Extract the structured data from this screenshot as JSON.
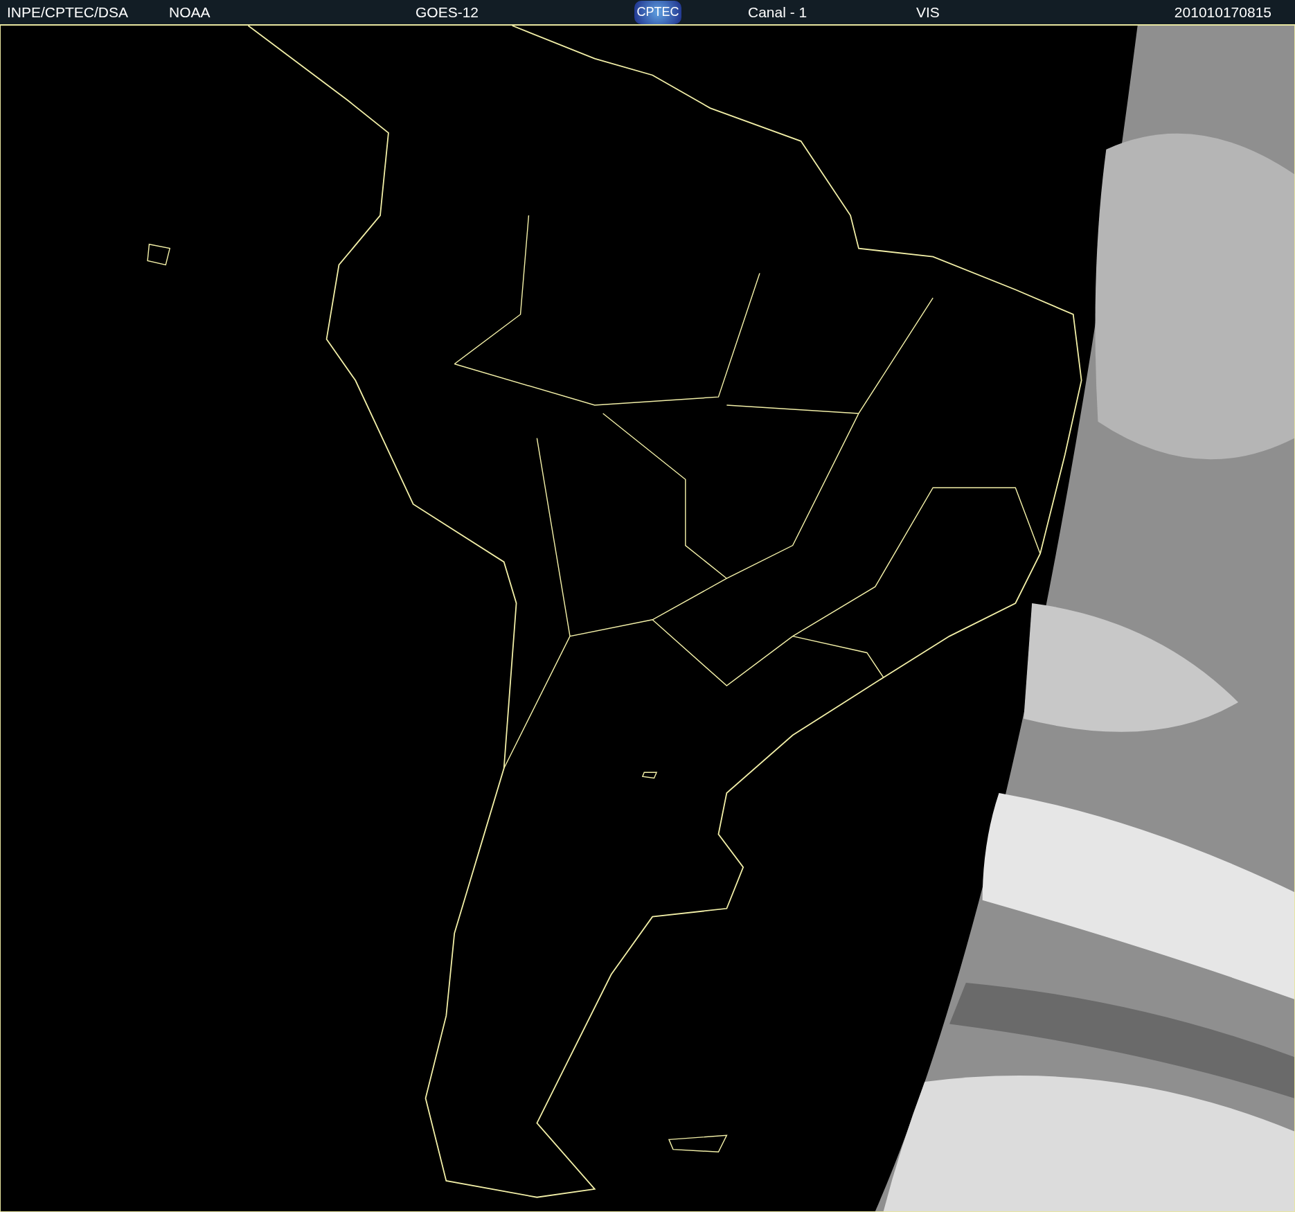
{
  "header": {
    "source": "INPE/CPTEC/DSA",
    "agency": "NOAA",
    "satellite": "GOES-12",
    "logo": "CPTEC",
    "channel": "Canal - 1",
    "band": "VIS",
    "timestamp": "201010170815"
  }
}
